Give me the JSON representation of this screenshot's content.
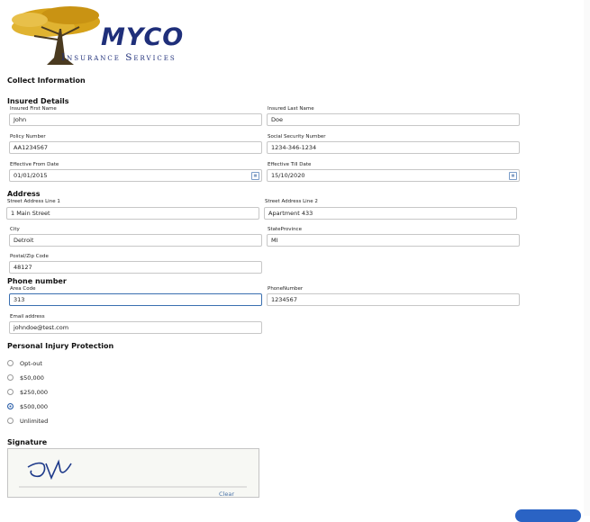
{
  "brand": {
    "name": "MYCO",
    "subtitle": "Insurance Services"
  },
  "form": {
    "title": "Collect Information",
    "insured_details": {
      "heading": "Insured Details",
      "first_name": {
        "label": "Insured First Name",
        "value": "John"
      },
      "last_name": {
        "label": "Insured Last Name",
        "value": "Doe"
      },
      "policy_number": {
        "label": "Policy Number",
        "value": "AA1234567"
      },
      "ssn": {
        "label": "Social Security Number",
        "value": "1234-346-1234"
      },
      "effective_from": {
        "label": "Effective From Date",
        "value": "01/01/2015"
      },
      "effective_till": {
        "label": "Effective Till Date",
        "value": "15/10/2020"
      }
    },
    "address": {
      "heading": "Address",
      "line1": {
        "label": "Street Address Line 1",
        "value": "1 Main Street"
      },
      "line2": {
        "label": "Street Address Line 2",
        "value": "Apartment 433"
      },
      "city": {
        "label": "City",
        "value": "Detroit"
      },
      "state": {
        "label": "StateProvince",
        "value": "MI"
      },
      "zip": {
        "label": "Postal/Zip Code",
        "value": "48127"
      }
    },
    "phone": {
      "heading": "Phone number",
      "area_code": {
        "label": "Area Code",
        "value": "313"
      },
      "number": {
        "label": "PhoneNumber",
        "value": "1234567"
      }
    },
    "email": {
      "label": "Email address",
      "value": "johndoe@test.com"
    },
    "pip": {
      "heading": "Personal Injury Protection",
      "options": [
        {
          "label": "Opt-out",
          "selected": false
        },
        {
          "label": "$50,000",
          "selected": false
        },
        {
          "label": "$250,000",
          "selected": false
        },
        {
          "label": "$500,000",
          "selected": true
        },
        {
          "label": "Unlimited",
          "selected": false
        }
      ]
    },
    "signature": {
      "heading": "Signature",
      "clear_label": "Clear"
    }
  },
  "colors": {
    "brand": "#1f2f7a",
    "accent": "#2a63c4"
  },
  "icons": {
    "calendar": "calendar-icon",
    "logo": "tree-logo"
  }
}
